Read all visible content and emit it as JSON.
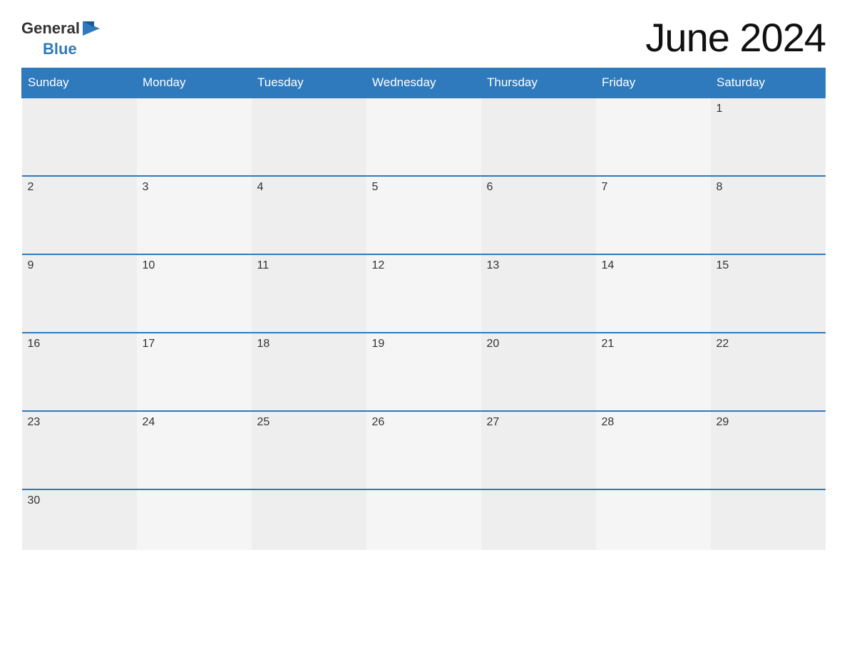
{
  "header": {
    "title": "June 2024",
    "logo": {
      "general": "General",
      "blue": "Blue"
    }
  },
  "calendar": {
    "days_of_week": [
      "Sunday",
      "Monday",
      "Tuesday",
      "Wednesday",
      "Thursday",
      "Friday",
      "Saturday"
    ],
    "weeks": [
      [
        null,
        null,
        null,
        null,
        null,
        null,
        1
      ],
      [
        2,
        3,
        4,
        5,
        6,
        7,
        8
      ],
      [
        9,
        10,
        11,
        12,
        13,
        14,
        15
      ],
      [
        16,
        17,
        18,
        19,
        20,
        21,
        22
      ],
      [
        23,
        24,
        25,
        26,
        27,
        28,
        29
      ],
      [
        30,
        null,
        null,
        null,
        null,
        null,
        null
      ]
    ]
  }
}
